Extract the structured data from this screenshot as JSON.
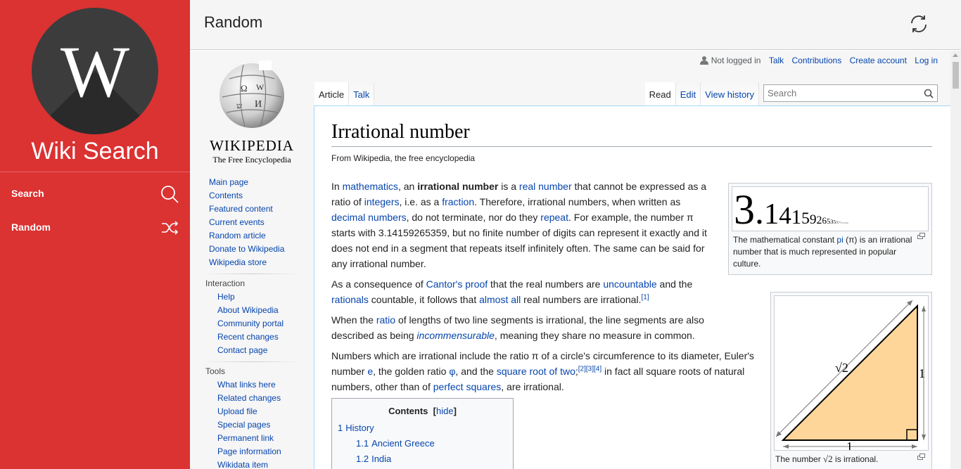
{
  "app": {
    "title": "Wiki Search",
    "logo_letter": "W",
    "accent_color": "#db3232",
    "nav": [
      {
        "label": "Search",
        "icon": "search-icon"
      },
      {
        "label": "Random",
        "icon": "shuffle-icon"
      }
    ]
  },
  "topbar": {
    "title": "Random",
    "refresh_icon": "refresh-icon"
  },
  "wiki": {
    "logo": {
      "wordmark": "Wikipedia",
      "tagline": "The Free Encyclopedia"
    },
    "navigation": [
      "Main page",
      "Contents",
      "Featured content",
      "Current events",
      "Random article",
      "Donate to Wikipedia",
      "Wikipedia store"
    ],
    "interaction": {
      "heading": "Interaction",
      "links": [
        "Help",
        "About Wikipedia",
        "Community portal",
        "Recent changes",
        "Contact page"
      ]
    },
    "tools": {
      "heading": "Tools",
      "links": [
        "What links here",
        "Related changes",
        "Upload file",
        "Special pages",
        "Permanent link",
        "Page information",
        "Wikidata item"
      ]
    },
    "personal": {
      "status": "Not logged in",
      "links": [
        "Talk",
        "Contributions",
        "Create account",
        "Log in"
      ]
    },
    "tabs_left": [
      "Article",
      "Talk"
    ],
    "tabs_right": [
      "Read",
      "Edit",
      "View history"
    ],
    "search_placeholder": "Search",
    "article": {
      "title": "Irrational number",
      "site_sub": "From Wikipedia, the free encyclopedia",
      "p1": [
        {
          "t": "In "
        },
        {
          "a": "mathematics"
        },
        {
          "t": ", an "
        },
        {
          "b": "irrational number"
        },
        {
          "t": " is a "
        },
        {
          "a": "real number"
        },
        {
          "t": " that cannot be expressed as a ratio of "
        },
        {
          "a": "integers"
        },
        {
          "t": ", i.e. as a "
        },
        {
          "a": "fraction"
        },
        {
          "t": ". Therefore, irrational numbers, when written as "
        },
        {
          "a": "decimal numbers"
        },
        {
          "t": ", do not terminate, nor do they "
        },
        {
          "a": "repeat"
        },
        {
          "t": ". For example, the number π starts with 3.14159265359, but no finite number of digits can represent it exactly and it does not end in a segment that repeats itself infinitely often. The same can be said for any irrational number."
        }
      ],
      "p2": [
        {
          "t": "As a consequence of "
        },
        {
          "a": "Cantor's proof"
        },
        {
          "t": " that the real numbers are "
        },
        {
          "a": "uncountable"
        },
        {
          "t": " and the "
        },
        {
          "a": "rationals"
        },
        {
          "t": " countable, it follows that "
        },
        {
          "a": "almost all"
        },
        {
          "t": " real numbers are irrational."
        },
        {
          "sup": "[1]"
        }
      ],
      "p3": [
        {
          "t": "When the "
        },
        {
          "a": "ratio"
        },
        {
          "t": " of lengths of two line segments is irrational, the line segments are also described as being "
        },
        {
          "ai": "incommensurable"
        },
        {
          "t": ", meaning they share no measure in common."
        }
      ],
      "p4": [
        {
          "t": "Numbers which are irrational include the ratio π of a circle's circumference to its diameter, Euler's number "
        },
        {
          "a": "e"
        },
        {
          "t": ", the golden ratio "
        },
        {
          "a": "φ"
        },
        {
          "t": ", and the "
        },
        {
          "a": "square root of two"
        },
        {
          "t": ";"
        },
        {
          "sup": "[2][3][4]"
        },
        {
          "t": " in fact all square roots of natural numbers, other than of "
        },
        {
          "a": "perfect squares"
        },
        {
          "t": ", are irrational."
        }
      ],
      "pi_image_text": "3.14159265358979323846",
      "thumb1_caption": [
        {
          "t": "The mathematical constant "
        },
        {
          "a": "pi"
        },
        {
          "t": " (π) is an irrational number that is much represented in popular culture."
        }
      ],
      "thumb2_caption_pre": "The number ",
      "thumb2_caption_post": " is irrational.",
      "sqrt2_label": "√2",
      "side_label": "1",
      "toc": {
        "title": "Contents",
        "hide": "hide",
        "items": [
          {
            "num": "1",
            "label": "History",
            "level": 1
          },
          {
            "num": "1.1",
            "label": "Ancient Greece",
            "level": 2
          },
          {
            "num": "1.2",
            "label": "India",
            "level": 2
          }
        ]
      }
    }
  }
}
